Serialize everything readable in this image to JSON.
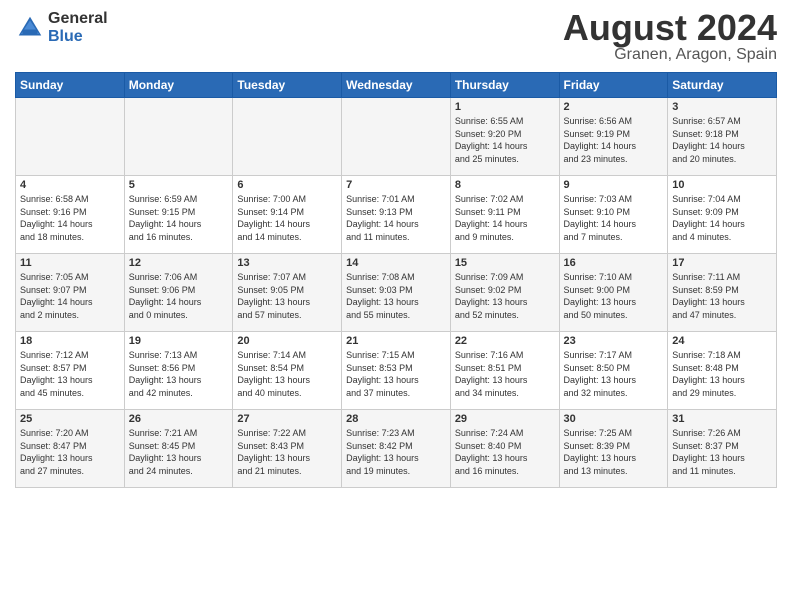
{
  "logo": {
    "general": "General",
    "blue": "Blue"
  },
  "title": "August 2024",
  "location": "Granen, Aragon, Spain",
  "days_header": [
    "Sunday",
    "Monday",
    "Tuesday",
    "Wednesday",
    "Thursday",
    "Friday",
    "Saturday"
  ],
  "weeks": [
    [
      {
        "day": "",
        "info": ""
      },
      {
        "day": "",
        "info": ""
      },
      {
        "day": "",
        "info": ""
      },
      {
        "day": "",
        "info": ""
      },
      {
        "day": "1",
        "info": "Sunrise: 6:55 AM\nSunset: 9:20 PM\nDaylight: 14 hours\nand 25 minutes."
      },
      {
        "day": "2",
        "info": "Sunrise: 6:56 AM\nSunset: 9:19 PM\nDaylight: 14 hours\nand 23 minutes."
      },
      {
        "day": "3",
        "info": "Sunrise: 6:57 AM\nSunset: 9:18 PM\nDaylight: 14 hours\nand 20 minutes."
      }
    ],
    [
      {
        "day": "4",
        "info": "Sunrise: 6:58 AM\nSunset: 9:16 PM\nDaylight: 14 hours\nand 18 minutes."
      },
      {
        "day": "5",
        "info": "Sunrise: 6:59 AM\nSunset: 9:15 PM\nDaylight: 14 hours\nand 16 minutes."
      },
      {
        "day": "6",
        "info": "Sunrise: 7:00 AM\nSunset: 9:14 PM\nDaylight: 14 hours\nand 14 minutes."
      },
      {
        "day": "7",
        "info": "Sunrise: 7:01 AM\nSunset: 9:13 PM\nDaylight: 14 hours\nand 11 minutes."
      },
      {
        "day": "8",
        "info": "Sunrise: 7:02 AM\nSunset: 9:11 PM\nDaylight: 14 hours\nand 9 minutes."
      },
      {
        "day": "9",
        "info": "Sunrise: 7:03 AM\nSunset: 9:10 PM\nDaylight: 14 hours\nand 7 minutes."
      },
      {
        "day": "10",
        "info": "Sunrise: 7:04 AM\nSunset: 9:09 PM\nDaylight: 14 hours\nand 4 minutes."
      }
    ],
    [
      {
        "day": "11",
        "info": "Sunrise: 7:05 AM\nSunset: 9:07 PM\nDaylight: 14 hours\nand 2 minutes."
      },
      {
        "day": "12",
        "info": "Sunrise: 7:06 AM\nSunset: 9:06 PM\nDaylight: 14 hours\nand 0 minutes."
      },
      {
        "day": "13",
        "info": "Sunrise: 7:07 AM\nSunset: 9:05 PM\nDaylight: 13 hours\nand 57 minutes."
      },
      {
        "day": "14",
        "info": "Sunrise: 7:08 AM\nSunset: 9:03 PM\nDaylight: 13 hours\nand 55 minutes."
      },
      {
        "day": "15",
        "info": "Sunrise: 7:09 AM\nSunset: 9:02 PM\nDaylight: 13 hours\nand 52 minutes."
      },
      {
        "day": "16",
        "info": "Sunrise: 7:10 AM\nSunset: 9:00 PM\nDaylight: 13 hours\nand 50 minutes."
      },
      {
        "day": "17",
        "info": "Sunrise: 7:11 AM\nSunset: 8:59 PM\nDaylight: 13 hours\nand 47 minutes."
      }
    ],
    [
      {
        "day": "18",
        "info": "Sunrise: 7:12 AM\nSunset: 8:57 PM\nDaylight: 13 hours\nand 45 minutes."
      },
      {
        "day": "19",
        "info": "Sunrise: 7:13 AM\nSunset: 8:56 PM\nDaylight: 13 hours\nand 42 minutes."
      },
      {
        "day": "20",
        "info": "Sunrise: 7:14 AM\nSunset: 8:54 PM\nDaylight: 13 hours\nand 40 minutes."
      },
      {
        "day": "21",
        "info": "Sunrise: 7:15 AM\nSunset: 8:53 PM\nDaylight: 13 hours\nand 37 minutes."
      },
      {
        "day": "22",
        "info": "Sunrise: 7:16 AM\nSunset: 8:51 PM\nDaylight: 13 hours\nand 34 minutes."
      },
      {
        "day": "23",
        "info": "Sunrise: 7:17 AM\nSunset: 8:50 PM\nDaylight: 13 hours\nand 32 minutes."
      },
      {
        "day": "24",
        "info": "Sunrise: 7:18 AM\nSunset: 8:48 PM\nDaylight: 13 hours\nand 29 minutes."
      }
    ],
    [
      {
        "day": "25",
        "info": "Sunrise: 7:20 AM\nSunset: 8:47 PM\nDaylight: 13 hours\nand 27 minutes."
      },
      {
        "day": "26",
        "info": "Sunrise: 7:21 AM\nSunset: 8:45 PM\nDaylight: 13 hours\nand 24 minutes."
      },
      {
        "day": "27",
        "info": "Sunrise: 7:22 AM\nSunset: 8:43 PM\nDaylight: 13 hours\nand 21 minutes."
      },
      {
        "day": "28",
        "info": "Sunrise: 7:23 AM\nSunset: 8:42 PM\nDaylight: 13 hours\nand 19 minutes."
      },
      {
        "day": "29",
        "info": "Sunrise: 7:24 AM\nSunset: 8:40 PM\nDaylight: 13 hours\nand 16 minutes."
      },
      {
        "day": "30",
        "info": "Sunrise: 7:25 AM\nSunset: 8:39 PM\nDaylight: 13 hours\nand 13 minutes."
      },
      {
        "day": "31",
        "info": "Sunrise: 7:26 AM\nSunset: 8:37 PM\nDaylight: 13 hours\nand 11 minutes."
      }
    ]
  ]
}
